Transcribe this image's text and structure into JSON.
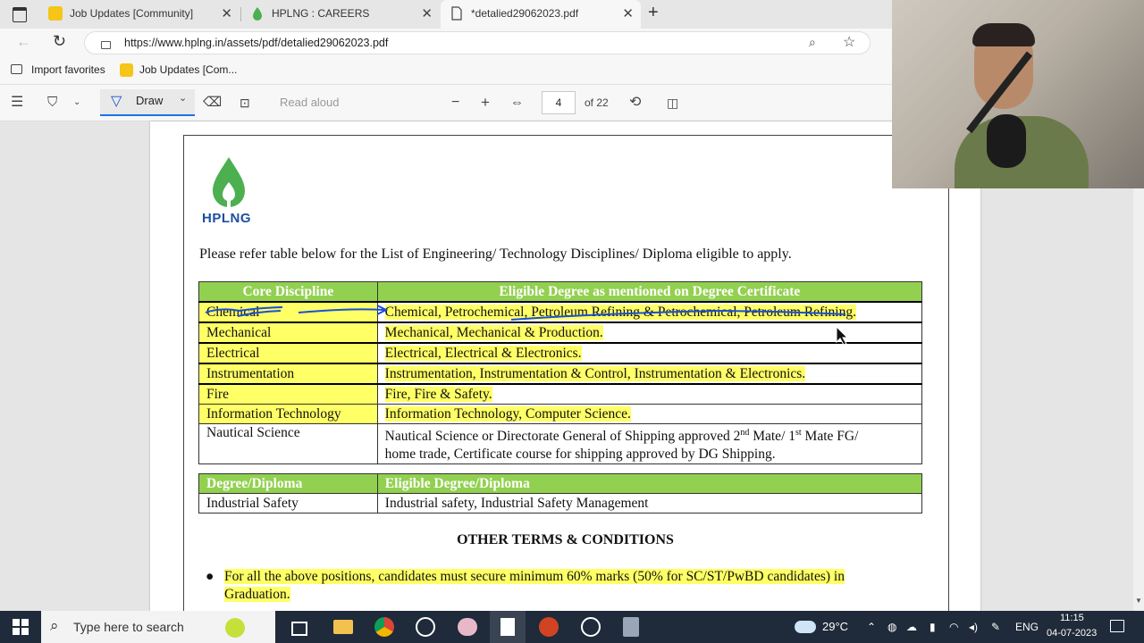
{
  "browser": {
    "tabs": [
      {
        "title": "Job Updates [Community]",
        "active": false
      },
      {
        "title": "HPLNG : CAREERS",
        "active": false
      },
      {
        "title": "*detalied29062023.pdf",
        "active": true
      }
    ],
    "url": "https://www.hplng.in/assets/pdf/detalied29062023.pdf",
    "favorites": [
      {
        "label": "Import favorites"
      },
      {
        "label": "Job Updates [Com..."
      }
    ]
  },
  "pdf_toolbar": {
    "draw_label": "Draw",
    "read_aloud": "Read aloud",
    "page_current": "4",
    "page_total": "of 22"
  },
  "document": {
    "logo_text": "HPLNG",
    "intro": "Please refer table below for the List of Engineering/ Technology Disciplines/ Diploma eligible to apply.",
    "table1": {
      "headers": [
        "Core Discipline",
        "Eligible Degree as mentioned on Degree Certificate"
      ],
      "rows": [
        {
          "discipline": "Chemical",
          "degree": "Chemical, Petrochemical, Petroleum Refining & Petrochemical, Petroleum Refining."
        },
        {
          "discipline": "Mechanical",
          "degree": "Mechanical, Mechanical & Production."
        },
        {
          "discipline": "Electrical",
          "degree": "Electrical, Electrical & Electronics."
        },
        {
          "discipline": "Instrumentation",
          "degree": "Instrumentation, Instrumentation & Control, Instrumentation & Electronics."
        },
        {
          "discipline": "Fire",
          "degree": "Fire, Fire & Safety."
        },
        {
          "discipline": "Information Technology",
          "degree": "Information Technology, Computer Science."
        }
      ],
      "nautical": {
        "discipline": "Nautical Science",
        "line1_a": "Nautical Science or Directorate General of Shipping approved 2",
        "sup1": "nd",
        "line1_b": " Mate/ 1",
        "sup2": "st",
        "line1_c": " Mate FG/",
        "line2": "home trade, Certificate course for shipping approved by DG Shipping."
      }
    },
    "table2": {
      "headers": [
        "Degree/Diploma",
        "Eligible Degree/Diploma"
      ],
      "rows": [
        {
          "discipline": "Industrial Safety",
          "degree": "Industrial safety, Industrial Safety Management"
        }
      ]
    },
    "heading2": "OTHER TERMS & CONDITIONS",
    "bullet1_a": "For all the above positions, candidates must secure minimum 60% marks (50% for SC/ST/PwBD candidates) in",
    "bullet1_b": "Graduation."
  },
  "taskbar": {
    "search_placeholder": "Type here to search",
    "weather": "29°C",
    "language": "ENG",
    "time": "11:15",
    "date": "04-07-2023"
  },
  "colors": {
    "table_header": "#92d050",
    "highlight": "#ffff66",
    "annotation": "#1a4fd6",
    "logo_green": "#4caf50",
    "logo_text": "#1d4fa0"
  }
}
